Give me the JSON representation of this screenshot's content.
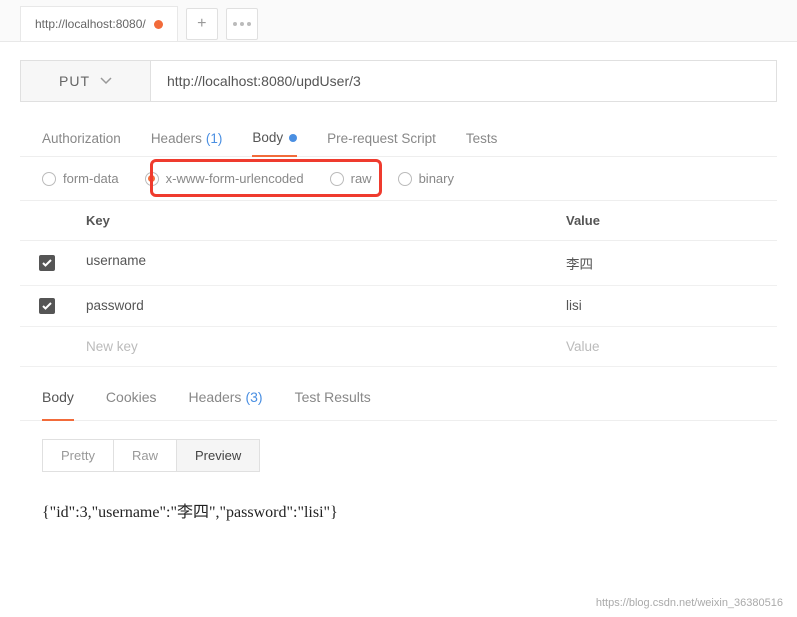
{
  "tabs": {
    "title": "http://localhost:8080/"
  },
  "request": {
    "method": "PUT",
    "url": "http://localhost:8080/updUser/3"
  },
  "reqTabs": {
    "auth": "Authorization",
    "headers": "Headers",
    "headersCount": "(1)",
    "body": "Body",
    "prereq": "Pre-request Script",
    "tests": "Tests"
  },
  "bodyTypes": {
    "formdata": "form-data",
    "urlencoded": "x-www-form-urlencoded",
    "raw": "raw",
    "binary": "binary"
  },
  "kv": {
    "keyHeader": "Key",
    "valueHeader": "Value",
    "rows": [
      {
        "key": "username",
        "value": "李四"
      },
      {
        "key": "password",
        "value": "lisi"
      }
    ],
    "placeholderKey": "New key",
    "placeholderValue": "Value"
  },
  "respTabs": {
    "body": "Body",
    "cookies": "Cookies",
    "headers": "Headers",
    "headersCount": "(3)",
    "testResults": "Test Results"
  },
  "viewModes": {
    "pretty": "Pretty",
    "raw": "Raw",
    "preview": "Preview"
  },
  "responseBody": "{\"id\":3,\"username\":\"李四\",\"password\":\"lisi\"}",
  "watermark": "https://blog.csdn.net/weixin_36380516"
}
